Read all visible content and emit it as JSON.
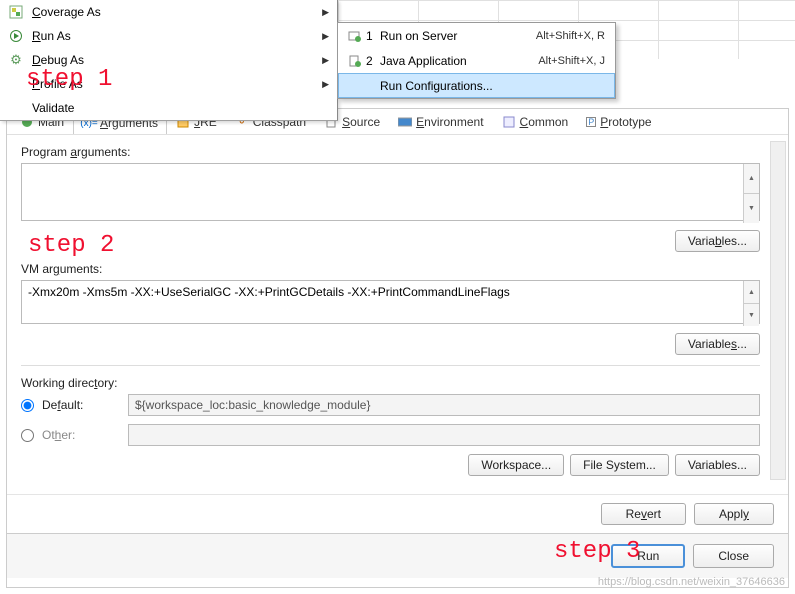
{
  "steps": {
    "s1": "step 1",
    "s2": "step 2",
    "s3": "step 3"
  },
  "context_menu": {
    "items": [
      {
        "label": "Coverage As",
        "icon": "coverage"
      },
      {
        "label": "Run As",
        "icon": "run"
      },
      {
        "label": "Debug As",
        "icon": "debug"
      },
      {
        "label": "Profile As",
        "icon": "profile"
      },
      {
        "label": "Validate",
        "icon": ""
      }
    ]
  },
  "submenu": {
    "items": [
      {
        "num": "1",
        "label": "Run on Server",
        "shortcut": "Alt+Shift+X, R"
      },
      {
        "num": "2",
        "label": "Java Application",
        "shortcut": "Alt+Shift+X, J"
      }
    ],
    "run_config": "Run Configurations..."
  },
  "tabs": {
    "main": "Main",
    "arguments": "Arguments",
    "jre": "JRE",
    "classpath": "Classpath",
    "source": "Source",
    "environment": "Environment",
    "common": "Common",
    "prototype": "Prototype"
  },
  "pane": {
    "program_args_label": "Program arguments:",
    "program_args_value": "",
    "vm_args_label": "VM arguments:",
    "vm_args_value": "-Xmx20m -Xms5m -XX:+UseSerialGC -XX:+PrintGCDetails -XX:+PrintCommandLineFlags",
    "variables_btn": "Variables...",
    "working_dir": {
      "label": "Working directory:",
      "default_label": "Default:",
      "default_value": "${workspace_loc:basic_knowledge_module}",
      "other_label": "Other:",
      "workspace_btn": "Workspace...",
      "filesystem_btn": "File System...",
      "variables_btn": "Variables..."
    }
  },
  "footer": {
    "revert": "Revert",
    "apply": "Apply",
    "run": "Run",
    "close": "Close"
  },
  "watermark": "https://blog.csdn.net/weixin_37646636"
}
